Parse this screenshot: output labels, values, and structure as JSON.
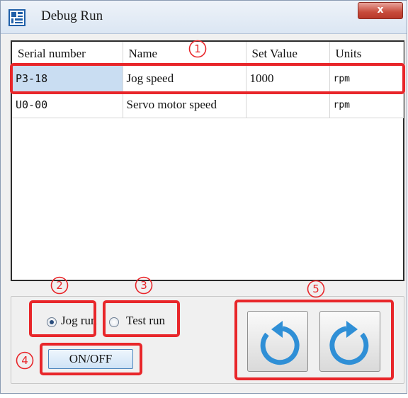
{
  "window": {
    "title": "Debug Run",
    "close_label": "x"
  },
  "table": {
    "columns": [
      "Serial number",
      "Name",
      "Set Value",
      "Units"
    ],
    "rows": [
      {
        "serial": "P3-18",
        "name": "Jog speed",
        "set_value": "1000",
        "units": "rpm",
        "selected": true
      },
      {
        "serial": "U0-00",
        "name": "Servo motor speed",
        "set_value": "",
        "units": "rpm",
        "selected": false
      }
    ]
  },
  "controls": {
    "jog_run_label": "Jog run",
    "jog_run_checked": true,
    "test_run_label": "Test run",
    "test_run_checked": false,
    "onoff_label": "ON/OFF",
    "rotate_ccw_icon": "rotate-counterclockwise-icon",
    "rotate_cw_icon": "rotate-clockwise-icon"
  },
  "annotations": {
    "markers": [
      "1",
      "2",
      "3",
      "4",
      "5"
    ],
    "highlight_color": "#e8262a"
  },
  "colors": {
    "selected_cell": "#c9ddf2",
    "rotate_arrow": "#2f8fd6",
    "close_button": "#c74a3a"
  }
}
